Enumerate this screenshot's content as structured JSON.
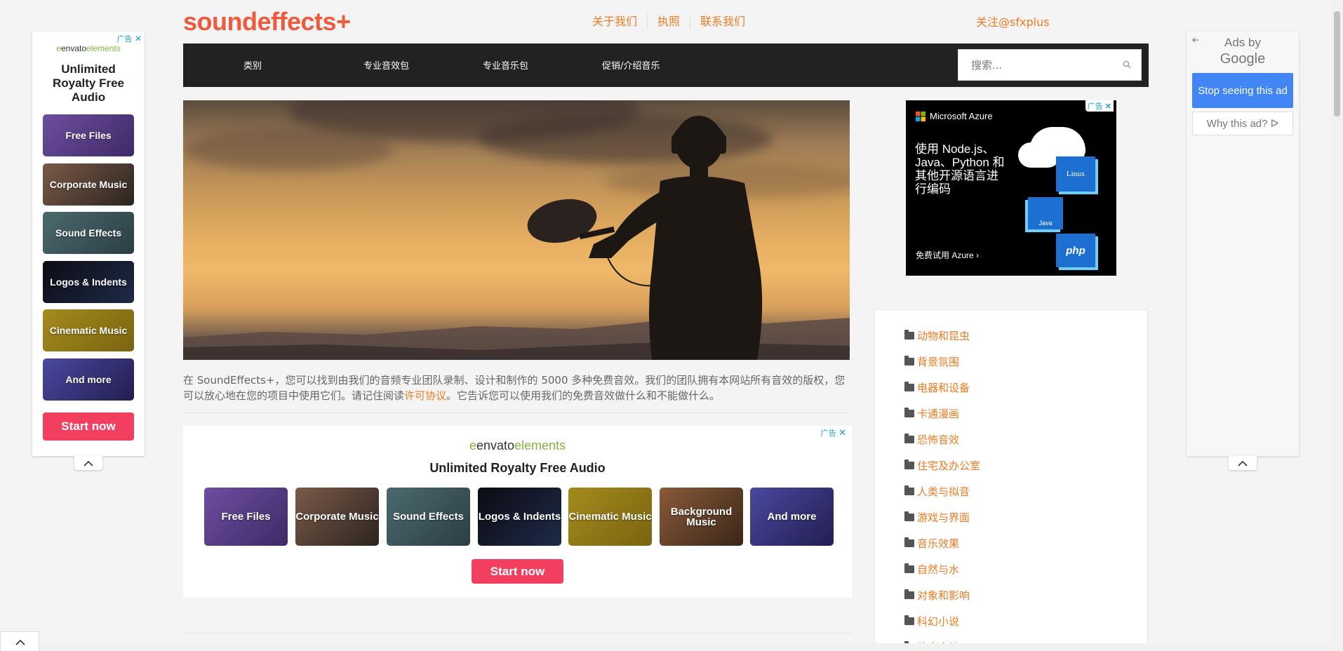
{
  "header": {
    "logo": "soundeffects+",
    "links": [
      "关于我们",
      "执照",
      "联系我们"
    ],
    "follow": "关注@sfxplus"
  },
  "nav": {
    "items": [
      "类别",
      "专业音效包",
      "专业音乐包",
      "促销/介绍音乐"
    ],
    "search_placeholder": "搜索..."
  },
  "intro": {
    "text_before": "在 SoundEffects+，您可以找到由我们的音频专业团队录制、设计和制作的 5000 多种免费音效。我们的团队拥有本网站所有音效的版权，您可以放心地在您的项目中使用它们。请记住阅读",
    "link": "许可协议",
    "text_after": "。它告诉您可以使用我们的免费音效做什么和不能做什么。"
  },
  "envato_ad": {
    "adchoice": "广告",
    "brand_leaf": "e",
    "brand": "envato",
    "brand_suffix": "elements",
    "headline": "Unlimited Royalty Free Audio",
    "tiles": [
      "Free Files",
      "Corporate Music",
      "Sound Effects",
      "Logos & Indents",
      "Cinematic Music",
      "Background Music",
      "And more"
    ],
    "cta": "Start now"
  },
  "left_ad": {
    "adchoice": "广告",
    "brand_leaf": "e",
    "brand": "envato",
    "brand_suffix": "elements",
    "headline": "Unlimited Royalty Free Audio",
    "tiles": [
      "Free Files",
      "Corporate Music",
      "Sound Effects",
      "Logos & Indents",
      "Cinematic Music",
      "And more"
    ],
    "cta": "Start now"
  },
  "google_ad": {
    "ads_by": "Ads by",
    "google": "Google",
    "stop": "Stop seeing this ad",
    "why": "Why this ad?"
  },
  "azure_ad": {
    "adchoice": "广告",
    "brand": "Microsoft Azure",
    "headline": "使用 Node.js、Java、Python 和其他开源语言进行编码",
    "cta": "免费试用 Azure",
    "tag_linux": "Linux",
    "tag_java": "Java",
    "tag_php": "php"
  },
  "categories": [
    "动物和昆虫",
    "背景氛围",
    "电器和设备",
    "卡通漫画",
    "恐怖音效",
    "住宅及办公室",
    "人类与拟音",
    "游戏与界面",
    "音乐效果",
    "自然与水",
    "对象和影响",
    "科幻小说",
    "体育音效"
  ],
  "colors": {
    "accent": "#f07b22",
    "logo": "#f05a3c",
    "nav_bg": "#222222",
    "cta": "#f33f5f",
    "google_blue": "#4285f4"
  }
}
